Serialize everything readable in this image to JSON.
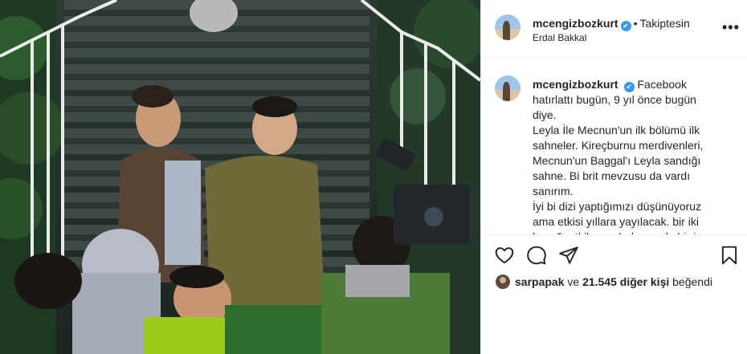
{
  "post": {
    "username": "mcengizbozkurt",
    "verified_badge": "✔",
    "separator": "•",
    "follow_status": "Takiptesin",
    "location": "Erdal Bakkal",
    "more_label": "•••",
    "caption": {
      "username": "mcengizbozkurt",
      "lines": [
        "Facebook hatırlattı bugün, 9 yıl önce bugün diye.",
        "Leyla İle Mecnun'un ilk bölümü ilk sahneler. Kireçburnu merdivenleri, Mecnun'un Baggal'ı Leyla sandığı sahne. Bi brit mevzusu da vardı sanırım.",
        "İyi bi dizi yaptığımızı düşünüyoruz ama etkisi yıllara yayılacak. bir iki kuşağı etkileyecek derecede bir iş çıkaracağımızdan bihaberiz. Len iyi ki"
      ]
    },
    "likes": {
      "first_liker": "sarpapak",
      "connector": "ve",
      "others": "21.545 diğer kişi",
      "suffix": "beğendi"
    }
  },
  "icons": {
    "like": "heart-icon",
    "comment": "comment-icon",
    "share": "paper-plane-icon",
    "save": "bookmark-icon",
    "more": "ellipsis-icon"
  },
  "colors": {
    "verified": "#3897f0",
    "text": "#262626",
    "divider": "#efefef"
  }
}
